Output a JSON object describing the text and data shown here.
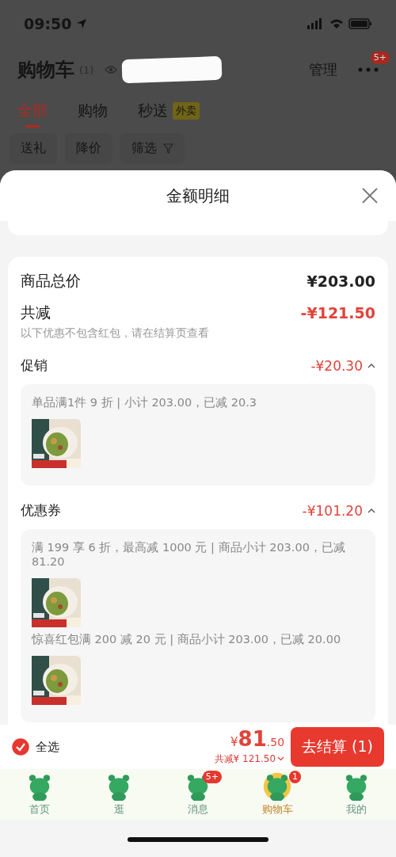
{
  "status_bar": {
    "time": "09:50"
  },
  "header": {
    "title": "购物车",
    "count": "(1)",
    "manage": "管理",
    "more_badge": "5+"
  },
  "tabs": [
    {
      "label": "全部",
      "selected": true
    },
    {
      "label": "购物",
      "selected": false
    },
    {
      "label": "秒送",
      "badge": "外卖",
      "selected": false
    }
  ],
  "filters": [
    {
      "label": "送礼",
      "kind": "plain"
    },
    {
      "label": "降价",
      "kind": "plain"
    },
    {
      "label": "筛选",
      "kind": "funnel"
    }
  ],
  "sheet": {
    "title": "金额明细",
    "total_label": "商品总价",
    "total": "¥203.00",
    "reduction_label": "共减",
    "reduction": "-¥121.50",
    "note": "以下优惠不包含红包，请在结算页查看",
    "sections": [
      {
        "title": "促销",
        "amount": "-¥20.30",
        "expanded": true,
        "items": [
          {
            "text": "单品满1件 9 折 | 小计 203.00，已减 20.3",
            "kind": "picture"
          }
        ]
      },
      {
        "title": "优惠券",
        "amount": "-¥101.20",
        "expanded": true,
        "items": [
          {
            "text": "满 199 享 6 折，最高减 1000 元 | 商品小计 203.00，已减 81.20",
            "kind": "picture"
          },
          {
            "text": "惊喜红包满 200 减 20 元 | 商品小计 203.00，已减 20.00",
            "kind": "picture"
          }
        ]
      }
    ]
  },
  "checkout": {
    "select_all": {
      "label": "全选",
      "checked": true
    },
    "currency": "¥",
    "price_int": "81",
    "price_dec": ".50",
    "saved": "共减¥ 121.50",
    "button": "去结算 (1)"
  },
  "nav": [
    {
      "label": "首页",
      "selected": false
    },
    {
      "label": "逛",
      "selected": false
    },
    {
      "label": "消息",
      "badge": "5+",
      "selected": false
    },
    {
      "label": "购物车",
      "badge": "1",
      "selected": true
    },
    {
      "label": "我的",
      "selected": false
    }
  ]
}
